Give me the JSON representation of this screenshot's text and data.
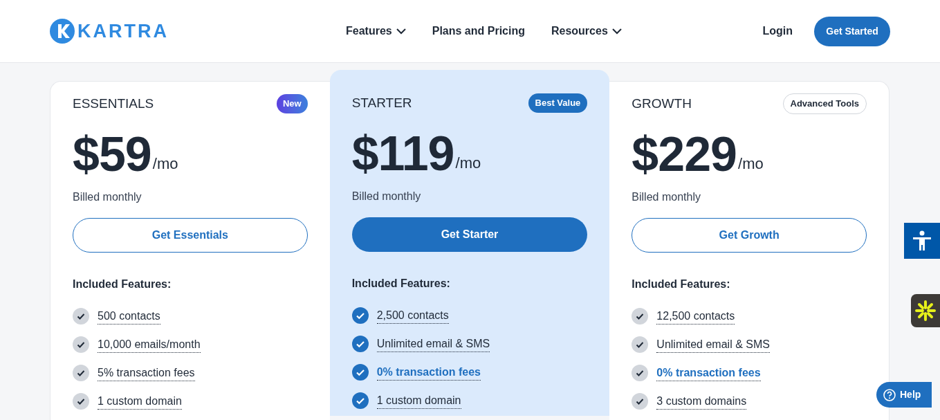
{
  "logo": {
    "text": "KARTRA"
  },
  "nav": [
    {
      "label": "Features",
      "dropdown": true
    },
    {
      "label": "Plans and Pricing",
      "dropdown": false
    },
    {
      "label": "Resources",
      "dropdown": true
    }
  ],
  "login": "Login",
  "cta": "Get Started",
  "plans": [
    {
      "name": "ESSENTIALS",
      "badge": {
        "text": "New",
        "kind": "gradient"
      },
      "price": "$59",
      "period": "/mo",
      "billing": "Billed monthly",
      "button": "Get Essentials",
      "featured": false,
      "features_title": "Included Features:",
      "features": [
        {
          "text": "500 contacts",
          "highlight": false
        },
        {
          "text": "10,000 emails/month",
          "highlight": false
        },
        {
          "text": "5% transaction fees",
          "highlight": false
        },
        {
          "text": "1 custom domain",
          "highlight": false
        }
      ]
    },
    {
      "name": "STARTER",
      "badge": {
        "text": "Best Value",
        "kind": "solid"
      },
      "price": "$119",
      "period": "/mo",
      "billing": "Billed monthly",
      "button": "Get Starter",
      "featured": true,
      "features_title": "Included Features:",
      "features": [
        {
          "text": "2,500 contacts",
          "highlight": false
        },
        {
          "text": "Unlimited email & SMS",
          "highlight": false
        },
        {
          "text": "0% transaction fees",
          "highlight": true
        },
        {
          "text": "1 custom domain",
          "highlight": false
        }
      ]
    },
    {
      "name": "GROWTH",
      "badge": {
        "text": "Advanced Tools",
        "kind": "outline"
      },
      "price": "$229",
      "period": "/mo",
      "billing": "Billed monthly",
      "button": "Get Growth",
      "featured": false,
      "features_title": "Included Features:",
      "features": [
        {
          "text": "12,500 contacts",
          "highlight": false
        },
        {
          "text": "Unlimited email & SMS",
          "highlight": false
        },
        {
          "text": "0% transaction fees",
          "highlight": true
        },
        {
          "text": "3 custom domains",
          "highlight": false
        }
      ]
    }
  ],
  "help": "Help"
}
